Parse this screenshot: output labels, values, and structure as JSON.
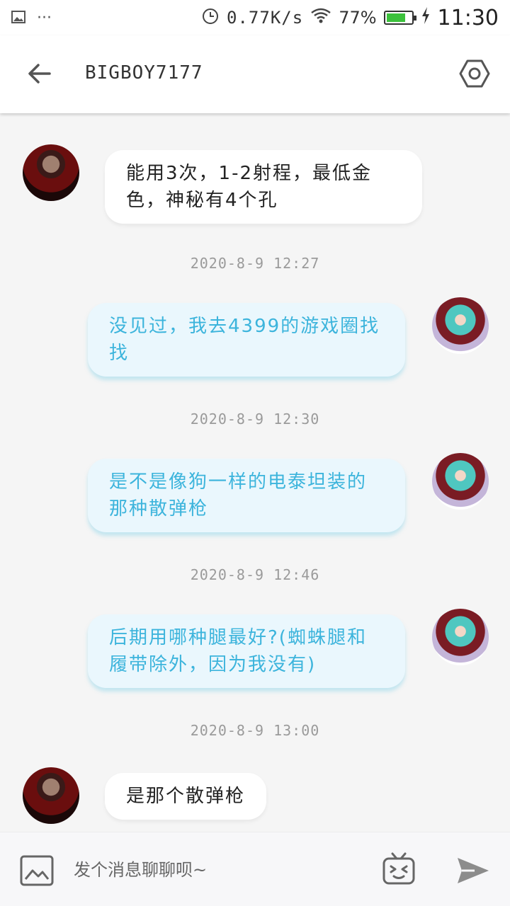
{
  "status_bar": {
    "speed": "0.77K/s",
    "battery_percent": "77%",
    "battery_level": 0.77,
    "time": "11:30",
    "icons": [
      "image-icon",
      "more-icon",
      "alarm-icon",
      "wifi-icon",
      "battery-icon",
      "charging-icon"
    ]
  },
  "header": {
    "title": "BIGBOY7177",
    "back_icon": "arrow-left-icon",
    "settings_icon": "hexagon-settings-icon"
  },
  "messages": [
    {
      "sender": "other",
      "text": "能用3次，1-2射程，最低金色，神秘有4个孔"
    },
    {
      "timestamp": "2020-8-9 12:27"
    },
    {
      "sender": "self",
      "text": "没见过，我去4399的游戏圈找找"
    },
    {
      "timestamp": "2020-8-9 12:30"
    },
    {
      "sender": "self",
      "text": "是不是像狗一样的电泰坦装的那种散弹枪"
    },
    {
      "timestamp": "2020-8-9 12:46"
    },
    {
      "sender": "self",
      "text": "后期用哪种腿最好?(蜘蛛腿和履带除外，因为我没有)"
    },
    {
      "timestamp": "2020-8-9 13:00"
    },
    {
      "sender": "other",
      "text": "是那个散弹枪"
    }
  ],
  "input_bar": {
    "placeholder": "发个消息聊聊呗~",
    "image_icon": "image-icon",
    "emoji_icon": "tv-emoji-icon",
    "send_icon": "send-icon"
  },
  "colors": {
    "self_bubble_bg": "#eaf7fd",
    "self_text": "#3cb4dc",
    "other_bubble_bg": "#ffffff",
    "timestamp": "#9a9a9a",
    "battery": "#3cc13c"
  }
}
